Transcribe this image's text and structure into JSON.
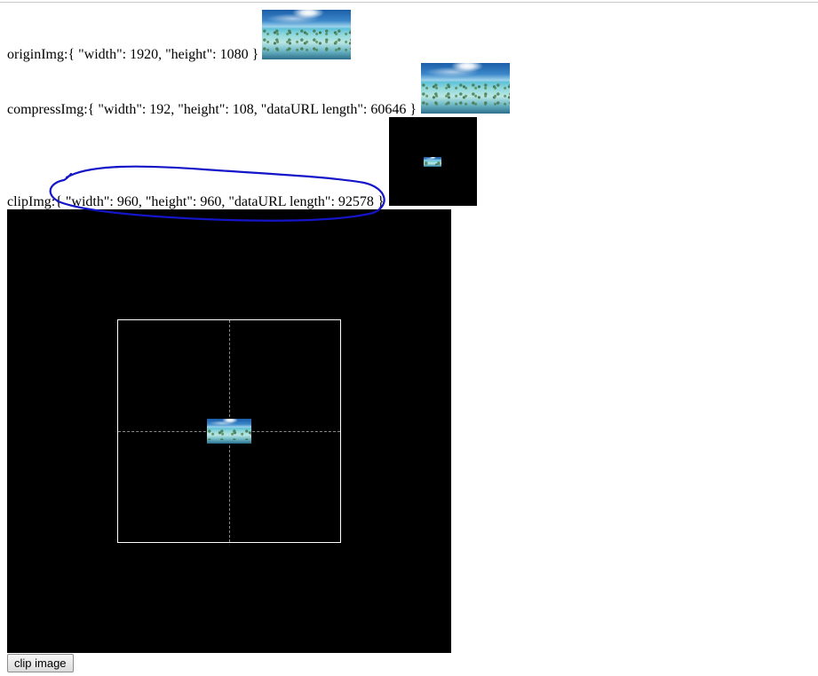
{
  "rows": {
    "origin": {
      "label": "originImg:",
      "json": "{ \"width\": 1920, \"height\": 1080 }"
    },
    "compress": {
      "label": "compressImg:",
      "json": "{ \"width\": 192, \"height\": 108, \"dataURL length\": 60646 }"
    },
    "clip": {
      "label": "clipImg:",
      "json": "{ \"width\": 960, \"height\": 960, \"dataURL length\": 92578 }"
    }
  },
  "images": {
    "origin_preview": "beach-thumbnail",
    "compress_preview": "beach-thumbnail",
    "clip_preview": "clipped-beach-on-black",
    "crop_source": "beach-thumbnail"
  },
  "annotation": {
    "color": "#1414c8",
    "shape": "hand-drawn-ellipse"
  },
  "colors": {
    "canvas_background": "#000000",
    "crop_border": "#ffffff",
    "guide_lines": "#8a8a8a"
  },
  "button": {
    "label": "clip image"
  }
}
